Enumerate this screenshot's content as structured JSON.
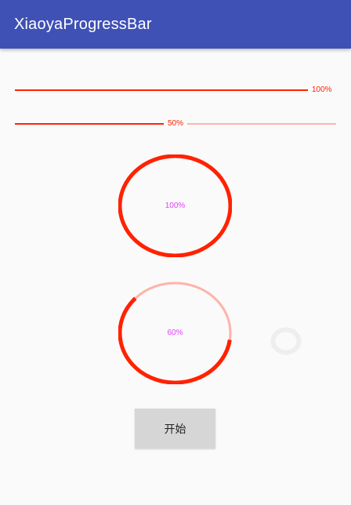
{
  "app": {
    "title": "XiaoyaProgressBar"
  },
  "horizontal_bars": [
    {
      "progress": 100,
      "label": "100%"
    },
    {
      "progress": 50,
      "label": "50%"
    }
  ],
  "circle_progress": [
    {
      "progress": 100,
      "label": "100%"
    },
    {
      "progress": 60,
      "label": "60%"
    }
  ],
  "colors": {
    "appbar": "#3f51b5",
    "reached": "#ff2200",
    "unreached": "#ffb3a8",
    "label_bar": "#ff2200",
    "label_circle": "#e040fb",
    "spinner": "#eeeeee",
    "button_bg": "#d6d6d6"
  },
  "actions": {
    "start_label": "开始"
  }
}
